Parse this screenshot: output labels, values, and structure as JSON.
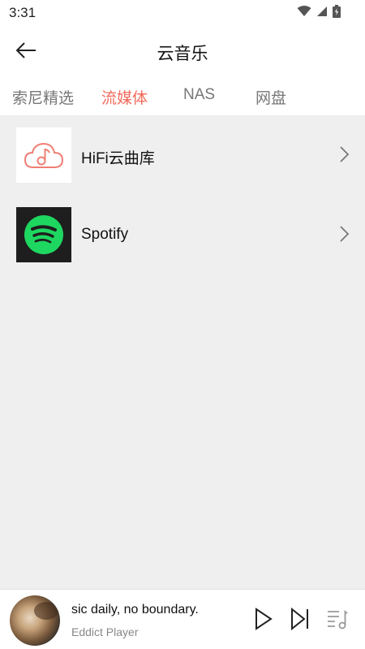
{
  "status_bar": {
    "time": "3:31"
  },
  "header": {
    "title": "云音乐"
  },
  "tabs": [
    {
      "label": "索尼精选",
      "active": false
    },
    {
      "label": "流媒体",
      "active": true
    },
    {
      "label": "NAS",
      "active": false
    },
    {
      "label": "网盘",
      "active": false
    }
  ],
  "services": [
    {
      "label": "HiFi云曲库",
      "icon": "cloud-music-icon"
    },
    {
      "label": "Spotify",
      "icon": "spotify-icon"
    }
  ],
  "player": {
    "title": "sic daily, no boundary.",
    "artist": "Eddict Player"
  },
  "colors": {
    "accent": "#f26b5b",
    "content_bg": "#efefef",
    "spotify_green": "#1ed760"
  }
}
